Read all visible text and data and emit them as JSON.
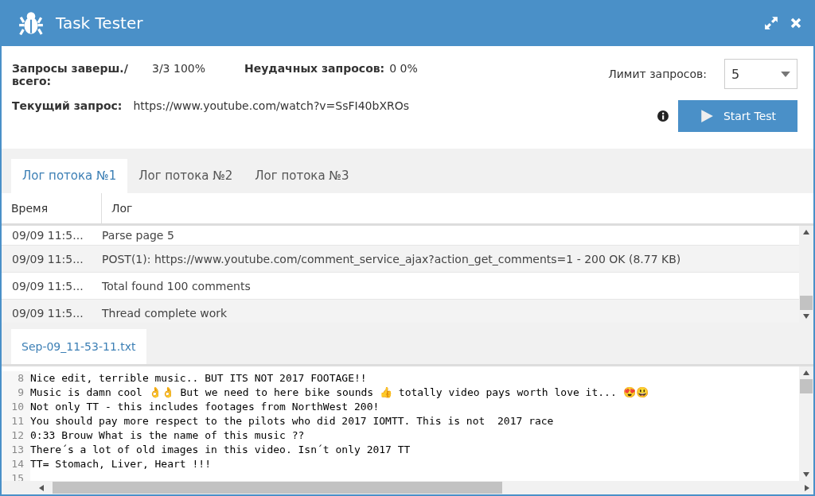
{
  "window": {
    "title": "Task Tester"
  },
  "stats": {
    "done_label": "Запросы заверш./ всего:",
    "done_value": "3/3 100%",
    "failed_label": "Неудачных запросов:",
    "failed_value": "0 0%",
    "current_label": "Текущий запрос:",
    "current_value": "https://www.youtube.com/watch?v=SsFI40bXROs"
  },
  "limit": {
    "label": "Лимит запросов:",
    "value": "5"
  },
  "start_button": "Start Test",
  "tabs": [
    {
      "label": "Лог потока №1",
      "selected": true
    },
    {
      "label": "Лог потока №2",
      "selected": false
    },
    {
      "label": "Лог потока №3",
      "selected": false
    }
  ],
  "table": {
    "columns": [
      "Время",
      "Лог"
    ],
    "rows": [
      {
        "time": "09/09 11:5...",
        "message": "Parse page 5"
      },
      {
        "time": "09/09 11:5...",
        "message": "POST(1): https://www.youtube.com/comment_service_ajax?action_get_comments=1 - 200 OK (8.77 KB)"
      },
      {
        "time": "09/09 11:5...",
        "message": "Total found 100 comments"
      },
      {
        "time": "09/09 11:5...",
        "message": "Thread complete work"
      }
    ]
  },
  "file_tab": {
    "label": "Sep-09_11-53-11.txt",
    "selected": true
  },
  "editor": {
    "lines": [
      {
        "number": "8",
        "text": "Nice edit, terrible music.. BUT ITS NOT 2017 FOOTAGE!!"
      },
      {
        "number": "9",
        "text": "Music is damn cool 👌👌 But we need to here bike sounds 👍 totally video pays worth love it... 😍😃"
      },
      {
        "number": "10",
        "text": "Not only TT - this includes footages from NorthWest 200!"
      },
      {
        "number": "11",
        "text": "You should pay more respect to the pilots who did 2017 IOMTT. This is not  2017 race"
      },
      {
        "number": "12",
        "text": "0:33 Brouw What is the name of this music ??"
      },
      {
        "number": "13",
        "text": "There´s a lot of old images in this video. Isn´t only 2017 TT"
      },
      {
        "number": "14",
        "text": "TT= Stomach, Liver, Heart !!!"
      },
      {
        "number": "15"
      }
    ]
  }
}
